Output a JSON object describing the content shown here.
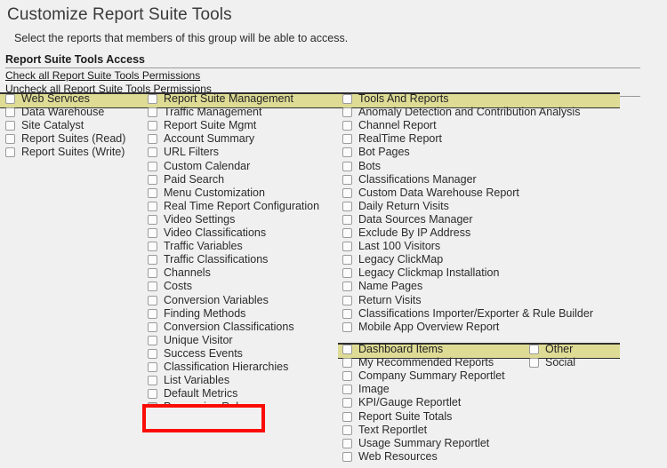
{
  "page": {
    "title": "Customize Report Suite Tools",
    "subtitle": "Select the reports that members of this group will be able to access.",
    "section_title": "Report Suite Tools Access",
    "check_all_link": "Check all Report Suite Tools Permissions",
    "uncheck_all_link": "Uncheck all Report Suite Tools Permissions"
  },
  "colors": {
    "band": "#dedb95",
    "page_background": "#f0f0f0",
    "highlight": "#fb0d07",
    "rule": "#2f2f2f"
  },
  "columns": [
    {
      "header": {
        "label": "Web Services",
        "checked": false
      },
      "items": [
        {
          "label": "Data Warehouse",
          "checked": false
        },
        {
          "label": "Site Catalyst",
          "checked": false
        },
        {
          "label": "Report Suites (Read)",
          "checked": false
        },
        {
          "label": "Report Suites (Write)",
          "checked": false
        }
      ]
    },
    {
      "header": {
        "label": "Report Suite Management",
        "checked": false
      },
      "items": [
        {
          "label": "Traffic Management",
          "checked": false
        },
        {
          "label": "Report Suite Mgmt",
          "checked": false
        },
        {
          "label": "Account Summary",
          "checked": false
        },
        {
          "label": "URL Filters",
          "checked": false
        },
        {
          "label": "Custom Calendar",
          "checked": false
        },
        {
          "label": "Paid Search",
          "checked": false
        },
        {
          "label": "Menu Customization",
          "checked": false
        },
        {
          "label": "Real Time Report Configuration",
          "checked": false
        },
        {
          "label": "Video Settings",
          "checked": false
        },
        {
          "label": "Video Classifications",
          "checked": false
        },
        {
          "label": "Traffic Variables",
          "checked": false
        },
        {
          "label": "Traffic Classifications",
          "checked": false
        },
        {
          "label": "Channels",
          "checked": false
        },
        {
          "label": "Costs",
          "checked": false
        },
        {
          "label": "Conversion Variables",
          "checked": false
        },
        {
          "label": "Finding Methods",
          "checked": false
        },
        {
          "label": "Conversion Classifications",
          "checked": false
        },
        {
          "label": "Unique Visitor",
          "checked": false
        },
        {
          "label": "Success Events",
          "checked": false
        },
        {
          "label": "Classification Hierarchies",
          "checked": false
        },
        {
          "label": "List Variables",
          "checked": false
        },
        {
          "label": "Default Metrics",
          "checked": false
        },
        {
          "label": "Processing Rules",
          "checked": true
        }
      ]
    },
    {
      "header": {
        "label": "Tools And Reports",
        "checked": false
      },
      "items": [
        {
          "label": "Anomaly Detection and Contribution Analysis",
          "checked": false
        },
        {
          "label": "Channel Report",
          "checked": false
        },
        {
          "label": "RealTime Report",
          "checked": false
        },
        {
          "label": "Bot Pages",
          "checked": false
        },
        {
          "label": "Bots",
          "checked": false
        },
        {
          "label": "Classifications Manager",
          "checked": false
        },
        {
          "label": "Custom Data Warehouse Report",
          "checked": false
        },
        {
          "label": "Daily Return Visits",
          "checked": false
        },
        {
          "label": "Data Sources Manager",
          "checked": false
        },
        {
          "label": "Exclude By IP Address",
          "checked": false
        },
        {
          "label": "Last 100 Visitors",
          "checked": false
        },
        {
          "label": "Legacy ClickMap",
          "checked": false
        },
        {
          "label": "Legacy Clickmap Installation",
          "checked": false
        },
        {
          "label": "Name Pages",
          "checked": false
        },
        {
          "label": "Return Visits",
          "checked": false
        },
        {
          "label": "Classifications Importer/Exporter & Rule Builder",
          "checked": false
        },
        {
          "label": "Mobile App Overview Report",
          "checked": false
        }
      ]
    },
    {
      "header": {
        "label": "Dashboard Items",
        "checked": false
      },
      "items": [
        {
          "label": "My Recommended Reports",
          "checked": false
        },
        {
          "label": "Company Summary Reportlet",
          "checked": false
        },
        {
          "label": "Image",
          "checked": false
        },
        {
          "label": "KPI/Gauge Reportlet",
          "checked": false
        },
        {
          "label": "Report Suite Totals",
          "checked": false
        },
        {
          "label": "Text Reportlet",
          "checked": false
        },
        {
          "label": "Usage Summary Reportlet",
          "checked": false
        },
        {
          "label": "Web Resources",
          "checked": false
        }
      ]
    },
    {
      "header": {
        "label": "Other",
        "checked": false
      },
      "items": [
        {
          "label": "Social",
          "checked": false
        }
      ]
    }
  ]
}
